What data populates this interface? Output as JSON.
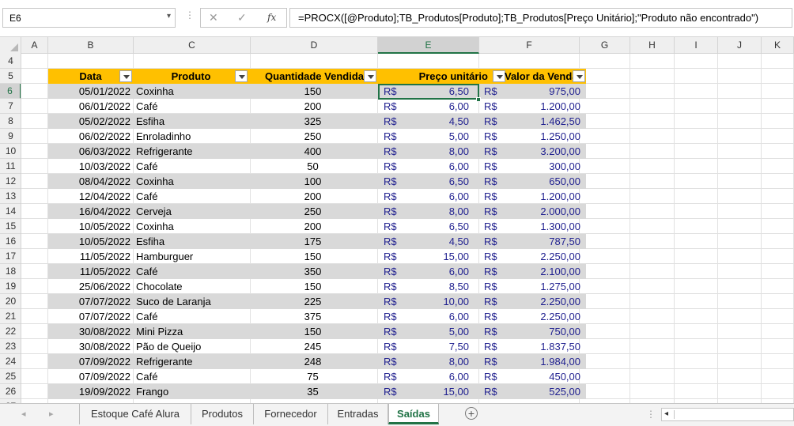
{
  "formula_bar": {
    "name_box": "E6",
    "name_box_arrow": "▾",
    "dots": "⋮",
    "cancel": "✕",
    "enter": "✓",
    "fx": "fx",
    "formula": "=PROCX([@Produto];TB_Produtos[Produto];TB_Produtos[Preço Unitário];\"Produto não encontrado\")"
  },
  "columns": [
    "A",
    "B",
    "C",
    "D",
    "E",
    "F",
    "G",
    "H",
    "I",
    "J",
    "K"
  ],
  "active_column": "E",
  "rows": [
    "4",
    "5",
    "6",
    "7",
    "8",
    "9",
    "10",
    "11",
    "12",
    "13",
    "14",
    "15",
    "16",
    "17",
    "18",
    "19",
    "20",
    "21",
    "22",
    "23",
    "24",
    "25",
    "26",
    "27"
  ],
  "active_row": "6",
  "table": {
    "headers": {
      "date": "Data",
      "product": "Produto",
      "quantity": "Quantidade Vendida",
      "price": "Preço unitário",
      "total": "Valor da Venda"
    },
    "currency": "R$",
    "rows": [
      {
        "date": "05/01/2022",
        "product": "Coxinha",
        "qty": "150",
        "price": "6,50",
        "total": "975,00"
      },
      {
        "date": "06/01/2022",
        "product": "Café",
        "qty": "200",
        "price": "6,00",
        "total": "1.200,00"
      },
      {
        "date": "05/02/2022",
        "product": "Esfiha",
        "qty": "325",
        "price": "4,50",
        "total": "1.462,50"
      },
      {
        "date": "06/02/2022",
        "product": "Enroladinho",
        "qty": "250",
        "price": "5,00",
        "total": "1.250,00"
      },
      {
        "date": "06/03/2022",
        "product": "Refrigerante",
        "qty": "400",
        "price": "8,00",
        "total": "3.200,00"
      },
      {
        "date": "10/03/2022",
        "product": "Café",
        "qty": "50",
        "price": "6,00",
        "total": "300,00"
      },
      {
        "date": "08/04/2022",
        "product": "Coxinha",
        "qty": "100",
        "price": "6,50",
        "total": "650,00"
      },
      {
        "date": "12/04/2022",
        "product": "Café",
        "qty": "200",
        "price": "6,00",
        "total": "1.200,00"
      },
      {
        "date": "16/04/2022",
        "product": "Cerveja",
        "qty": "250",
        "price": "8,00",
        "total": "2.000,00"
      },
      {
        "date": "10/05/2022",
        "product": "Coxinha",
        "qty": "200",
        "price": "6,50",
        "total": "1.300,00"
      },
      {
        "date": "10/05/2022",
        "product": "Esfiha",
        "qty": "175",
        "price": "4,50",
        "total": "787,50"
      },
      {
        "date": "11/05/2022",
        "product": "Hamburguer",
        "qty": "150",
        "price": "15,00",
        "total": "2.250,00"
      },
      {
        "date": "11/05/2022",
        "product": "Café",
        "qty": "350",
        "price": "6,00",
        "total": "2.100,00"
      },
      {
        "date": "25/06/2022",
        "product": "Chocolate",
        "qty": "150",
        "price": "8,50",
        "total": "1.275,00"
      },
      {
        "date": "07/07/2022",
        "product": "Suco de Laranja",
        "qty": "225",
        "price": "10,00",
        "total": "2.250,00"
      },
      {
        "date": "07/07/2022",
        "product": "Café",
        "qty": "375",
        "price": "6,00",
        "total": "2.250,00"
      },
      {
        "date": "30/08/2022",
        "product": "Mini Pizza",
        "qty": "150",
        "price": "5,00",
        "total": "750,00"
      },
      {
        "date": "30/08/2022",
        "product": "Pão de Queijo",
        "qty": "245",
        "price": "7,50",
        "total": "1.837,50"
      },
      {
        "date": "07/09/2022",
        "product": "Refrigerante",
        "qty": "248",
        "price": "8,00",
        "total": "1.984,00"
      },
      {
        "date": "07/09/2022",
        "product": "Café",
        "qty": "75",
        "price": "6,00",
        "total": "450,00"
      },
      {
        "date": "19/09/2022",
        "product": "Frango",
        "qty": "35",
        "price": "15,00",
        "total": "525,00"
      }
    ]
  },
  "sheet_tabs": {
    "nav_prev": "◂",
    "nav_next": "▸",
    "tabs": [
      "Estoque Café Alura",
      "Produtos",
      "Fornecedor",
      "Entradas",
      "Saídas"
    ],
    "active": "Saídas",
    "add_sheet": "+",
    "dots": "⋮",
    "scroll_left": "◂"
  },
  "colors": {
    "header_fill": "#ffc000",
    "band_fill": "#d9d9d9",
    "excel_green": "#217346",
    "currency_text": "#1f1f8f"
  }
}
